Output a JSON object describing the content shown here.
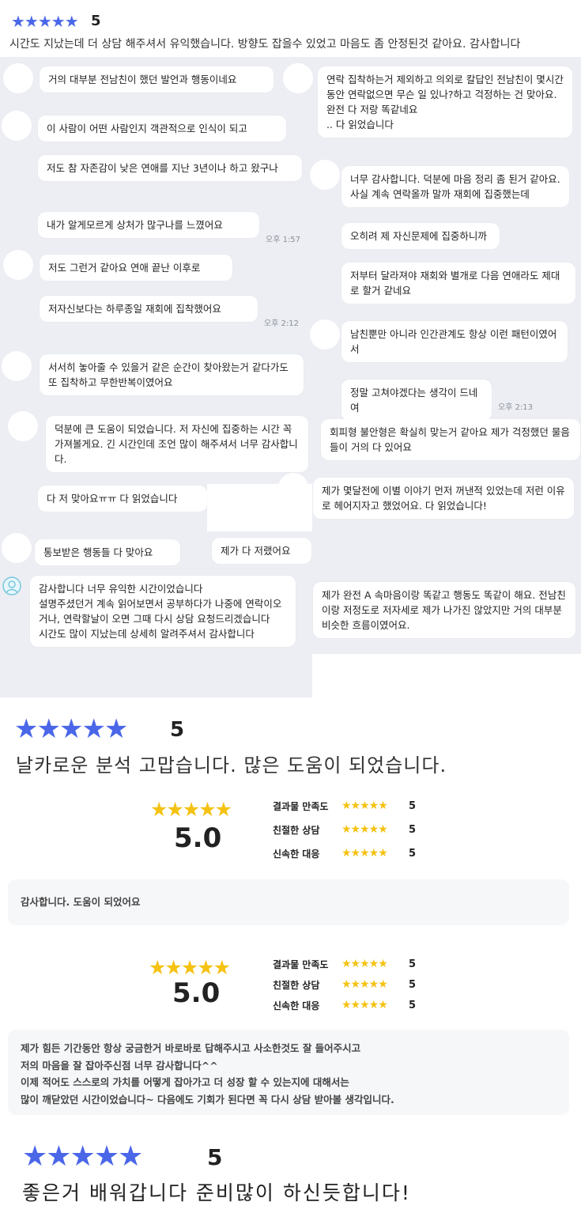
{
  "review1": {
    "stars": "★★★★★",
    "score": "5",
    "text": "시간도 지났는데 더 상담 해주셔서 유익했습니다. 방향도 잡을수 있었고 마음도 좀 안정된것 같아요. 감사합니다"
  },
  "chat": {
    "left": [
      "거의 대부분 전남친이 했던 발언과 행동이네요",
      "이 사람이 어떤 사람인지 객관적으로 인식이 되고",
      "저도 참 자존감이 낮은 연애를 지난 3년이나 하고 왔구나",
      "내가 알게모르게 상처가 많구나를 느꼈어요",
      "저도 그런거 같아요 연애 끝난 이후로",
      "저자신보다는 하루종일 재회에 집착했어요",
      "서서히 놓아줄 수 있을거 같은 순간이 찾아왔는거 같다가도 또 집착하고 무한반복이였어요",
      "덕분에 큰 도움이 되었습니다. 저 자신에 집중하는 시간 꼭 가져볼게요. 긴 시간인데 조언 많이 해주셔서 너무 감사합니다.",
      "다 저 맞아요ㅠㅠ 다 읽었습니다",
      "통보받은 행동들 다 맞아요",
      "감사합니다 너무 유익한 시간이었습니다\n설명주셨던거 계속 읽어보면서 공부하다가 나중에 연락이오거나, 연락할날이 오면 그때 다시 상담 요청드리겠습니다\n시간도 많이 지났는데 상세히 알려주셔서 감사합니다"
    ],
    "right": [
      "연락 집착하는거 제외하고 의외로 칼답인 전남친이 몇시간동안 연락없으면 무슨 일 있나?하고 걱정하는 건 맞아요. 완전 다 저랑 똑같네요\n.. 다 읽었습니다",
      "너무 감사합니다. 덕분에 마음 정리 좀 된거 같아요. 사실 계속 연락올까 말까 재회에 집중했는데",
      "오히려 제 자신문제에 집중하니까",
      "저부터 달라져야 재회와 별개로 다음 연애라도 제대로 할거 같네요",
      "남친뿐만 아니라 인간관계도 항상 이런 패턴이였어서",
      "정말 고쳐야겠다는 생각이 드네여",
      "회피형 불안형은 확실히 맞는거 같아요 제가 걱정했던 물음들이 거의 다 있어요",
      "제가 몇달전에 이별 이야기 먼저 꺼낸적 있었는데 저런 이유로 헤어지자고 했었어요. 다 읽었습니다!",
      "제가 다 저랬어요",
      "제가 완전 A 속마음이랑 똑같고 행동도 똑같이 해요. 전남친이랑 저정도로 저자세로 제가 나가진 않았지만 거의 대부분 비슷한 흐름이였어요."
    ],
    "timestamps": [
      "오후 1:57",
      "오후 2:12",
      "오후 2:13"
    ]
  },
  "review2": {
    "stars": "★★★★★",
    "score": "5",
    "text": "날카로운 분석 고맙습니다. 많은 도움이 되었습니다."
  },
  "rating1": {
    "stars": "★★★★★",
    "score": "5.0",
    "rows": [
      {
        "label": "결과물 만족도",
        "stars": "★★★★★",
        "value": "5"
      },
      {
        "label": "친절한 상담",
        "stars": "★★★★★",
        "value": "5"
      },
      {
        "label": "신속한 대응",
        "stars": "★★★★★",
        "value": "5"
      }
    ],
    "comment": "감사합니다. 도움이 되었어요"
  },
  "rating2": {
    "stars": "★★★★★",
    "score": "5.0",
    "rows": [
      {
        "label": "결과물 만족도",
        "stars": "★★★★★",
        "value": "5"
      },
      {
        "label": "친절한 상담",
        "stars": "★★★★★",
        "value": "5"
      },
      {
        "label": "신속한 대응",
        "stars": "★★★★★",
        "value": "5"
      }
    ],
    "comment_lines": [
      "제가 힘든 기간동안 항상 궁금한거 바로바로 답해주시고 사소한것도 잘 들어주시고",
      "저의 마음을 잘 잡아주신점 너무 감사합니다^^",
      "이제 적어도 스스로의 가치를 어떻게 잡아가고 더 성장 할 수 있는지에 대해서는",
      "많이 깨닫았던 시간이었습니다~ 다음에도 기회가 된다면 꼭 다시 상담 받아볼 생각입니다."
    ]
  },
  "review3": {
    "stars": "★★★★★",
    "score": "5",
    "text": "좋은거 배워갑니다 준비많이 하신듯합니다!"
  },
  "colors": {
    "star_blue": "#4a67e8",
    "star_gold": "#f5c211",
    "chat_bg": "#eceef3",
    "comment_bg": "#f6f7f9"
  }
}
